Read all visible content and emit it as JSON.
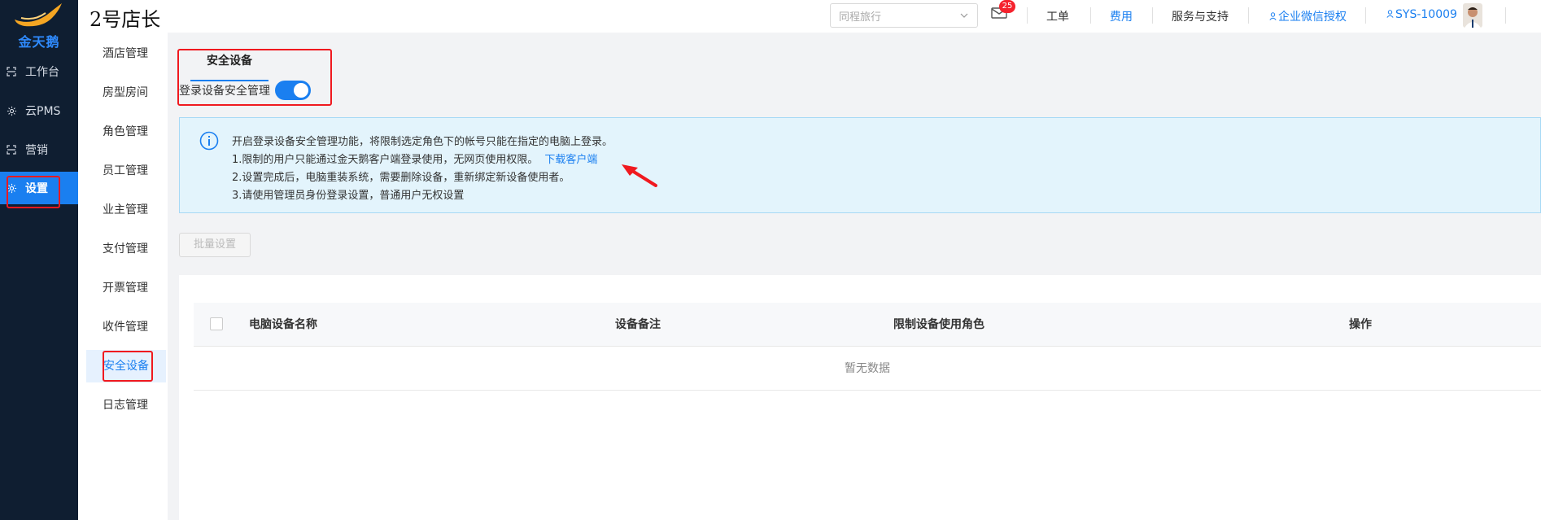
{
  "app": {
    "logo_text": "金天鹅",
    "store_name": "2号店长"
  },
  "leftnav": {
    "items": [
      {
        "label": "工作台",
        "icon": "workbench-icon"
      },
      {
        "label": "云PMS",
        "icon": "gear-icon"
      },
      {
        "label": "营销",
        "icon": "marketing-icon"
      },
      {
        "label": "设置",
        "icon": "settings-icon"
      }
    ]
  },
  "header": {
    "hotel_select_value": "同程旅行",
    "notification_count": "25",
    "links": {
      "work_order": "工单",
      "fees": "费用",
      "service": "服务与支持",
      "wechat_auth": "企业微信授权",
      "user": "SYS-10009"
    }
  },
  "subnav": {
    "items": [
      "酒店管理",
      "房型房间",
      "角色管理",
      "员工管理",
      "业主管理",
      "支付管理",
      "开票管理",
      "收件管理",
      "安全设备",
      "日志管理"
    ],
    "active": "安全设备"
  },
  "main": {
    "tab_label": "安全设备",
    "toggle_label": "登录设备安全管理",
    "toggle_on": true,
    "info": {
      "line1": "开启登录设备安全管理功能，将限制选定角色下的帐号只能在指定的电脑上登录。",
      "line2": "1.限制的用户只能通过金天鹅客户端登录使用，无网页使用权限。",
      "line2_link": "下载客户端",
      "line3": "2.设置完成后，电脑重装系统，需要删除设备，重新绑定新设备使用者。",
      "line4": "3.请使用管理员身份登录设置，普通用户无权设置"
    },
    "batch_button": "批量设置",
    "table": {
      "columns": [
        "电脑设备名称",
        "设备备注",
        "限制设备使用角色",
        "操作"
      ],
      "empty_text": "暂无数据"
    }
  },
  "colors": {
    "accent": "#1a7ff0",
    "nav_bg": "#0f1e31",
    "highlight_red": "#f0191f"
  }
}
